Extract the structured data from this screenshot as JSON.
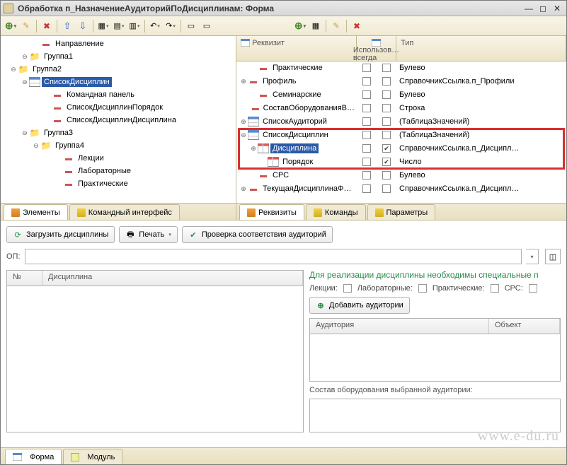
{
  "window": {
    "title": "Обработка п_НазначениеАудиторийПоДисциплинам: Форма"
  },
  "tree": [
    {
      "indent": 2,
      "toggle": "",
      "icon": "dash",
      "label": "Направление"
    },
    {
      "indent": 1,
      "toggle": "⊖",
      "icon": "folder",
      "label": "Группа1"
    },
    {
      "indent": 0,
      "toggle": "⊖",
      "icon": "folder",
      "label": "Группа2"
    },
    {
      "indent": 1,
      "toggle": "⊖",
      "icon": "table",
      "label": "СписокДисциплин",
      "selected": true
    },
    {
      "indent": 3,
      "toggle": "",
      "icon": "dash",
      "label": "Командная панель"
    },
    {
      "indent": 3,
      "toggle": "",
      "icon": "dash",
      "label": "СписокДисциплинПорядок"
    },
    {
      "indent": 3,
      "toggle": "",
      "icon": "dash",
      "label": "СписокДисциплинДисциплина"
    },
    {
      "indent": 1,
      "toggle": "⊖",
      "icon": "folder",
      "label": "Группа3"
    },
    {
      "indent": 2,
      "toggle": "⊖",
      "icon": "folder",
      "label": "Группа4"
    },
    {
      "indent": 4,
      "toggle": "",
      "icon": "dash",
      "label": "Лекции"
    },
    {
      "indent": 4,
      "toggle": "",
      "icon": "dash",
      "label": "Лабораторные"
    },
    {
      "indent": 4,
      "toggle": "",
      "icon": "dash",
      "label": "Практические"
    }
  ],
  "left_tabs": {
    "elements": "Элементы",
    "cmdif": "Командный интерфейс"
  },
  "grid": {
    "headers": {
      "attr": "Реквизит",
      "use": "Использов… всегда",
      "type": "Тип"
    },
    "rows": [
      {
        "indent": 1,
        "toggle": "",
        "icon": "dash",
        "label": "Практические",
        "use": false,
        "chk": false,
        "type": "Булево"
      },
      {
        "indent": 0,
        "toggle": "⊕",
        "icon": "dash",
        "label": "Профиль",
        "use": false,
        "chk": false,
        "type": "СправочникСсылка.п_Профили"
      },
      {
        "indent": 1,
        "toggle": "",
        "icon": "dash",
        "label": "Семинарские",
        "use": false,
        "chk": false,
        "type": "Булево"
      },
      {
        "indent": 1,
        "toggle": "",
        "icon": "dash",
        "label": "СоставОборудованияВ…",
        "use": false,
        "chk": false,
        "type": "Строка"
      },
      {
        "indent": 0,
        "toggle": "⊕",
        "icon": "table",
        "label": "СписокАудиторий",
        "use": false,
        "chk": false,
        "type": "(ТаблицаЗначений)"
      },
      {
        "indent": 0,
        "toggle": "⊖",
        "icon": "table",
        "label": "СписокДисциплин",
        "use": false,
        "chk": false,
        "type": "(ТаблицаЗначений)",
        "hl": true
      },
      {
        "indent": 1,
        "toggle": "⊕",
        "icon": "col",
        "label": "Дисциплина",
        "use": false,
        "chk": true,
        "type": "СправочникСсылка.п_Дисципл…",
        "hl": true,
        "selected": true
      },
      {
        "indent": 2,
        "toggle": "",
        "icon": "col",
        "label": "Порядок",
        "use": false,
        "chk": true,
        "type": "Число",
        "hl": true
      },
      {
        "indent": 1,
        "toggle": "",
        "icon": "dash",
        "label": "СРС",
        "use": false,
        "chk": false,
        "type": "Булево"
      },
      {
        "indent": 0,
        "toggle": "⊕",
        "icon": "dash",
        "label": "ТекущаяДисциплинаФ…",
        "use": false,
        "chk": false,
        "type": "СправочникСсылка.п_Дисципл…"
      }
    ]
  },
  "right_tabs": {
    "attrs": "Реквизиты",
    "cmds": "Команды",
    "params": "Параметры"
  },
  "form": {
    "load": "Загрузить дисциплины",
    "print": "Печать",
    "check": "Проверка соответствия аудиторий",
    "op_label": "ОП:",
    "table": {
      "num": "№",
      "disc": "Дисциплина"
    },
    "info": "Для реализации дисциплины необходимы специальные п",
    "checks": {
      "lec": "Лекции:",
      "lab": "Лабораторные:",
      "prac": "Практические:",
      "srs": "СРС:"
    },
    "add_room": "Добавить аудитории",
    "room_table": {
      "room": "Аудитория",
      "obj": "Объект"
    },
    "equip": "Состав оборудования выбранной аудитории:"
  },
  "bottom_tabs": {
    "form": "Форма",
    "module": "Модуль"
  },
  "watermark": "www.e-du.ru"
}
